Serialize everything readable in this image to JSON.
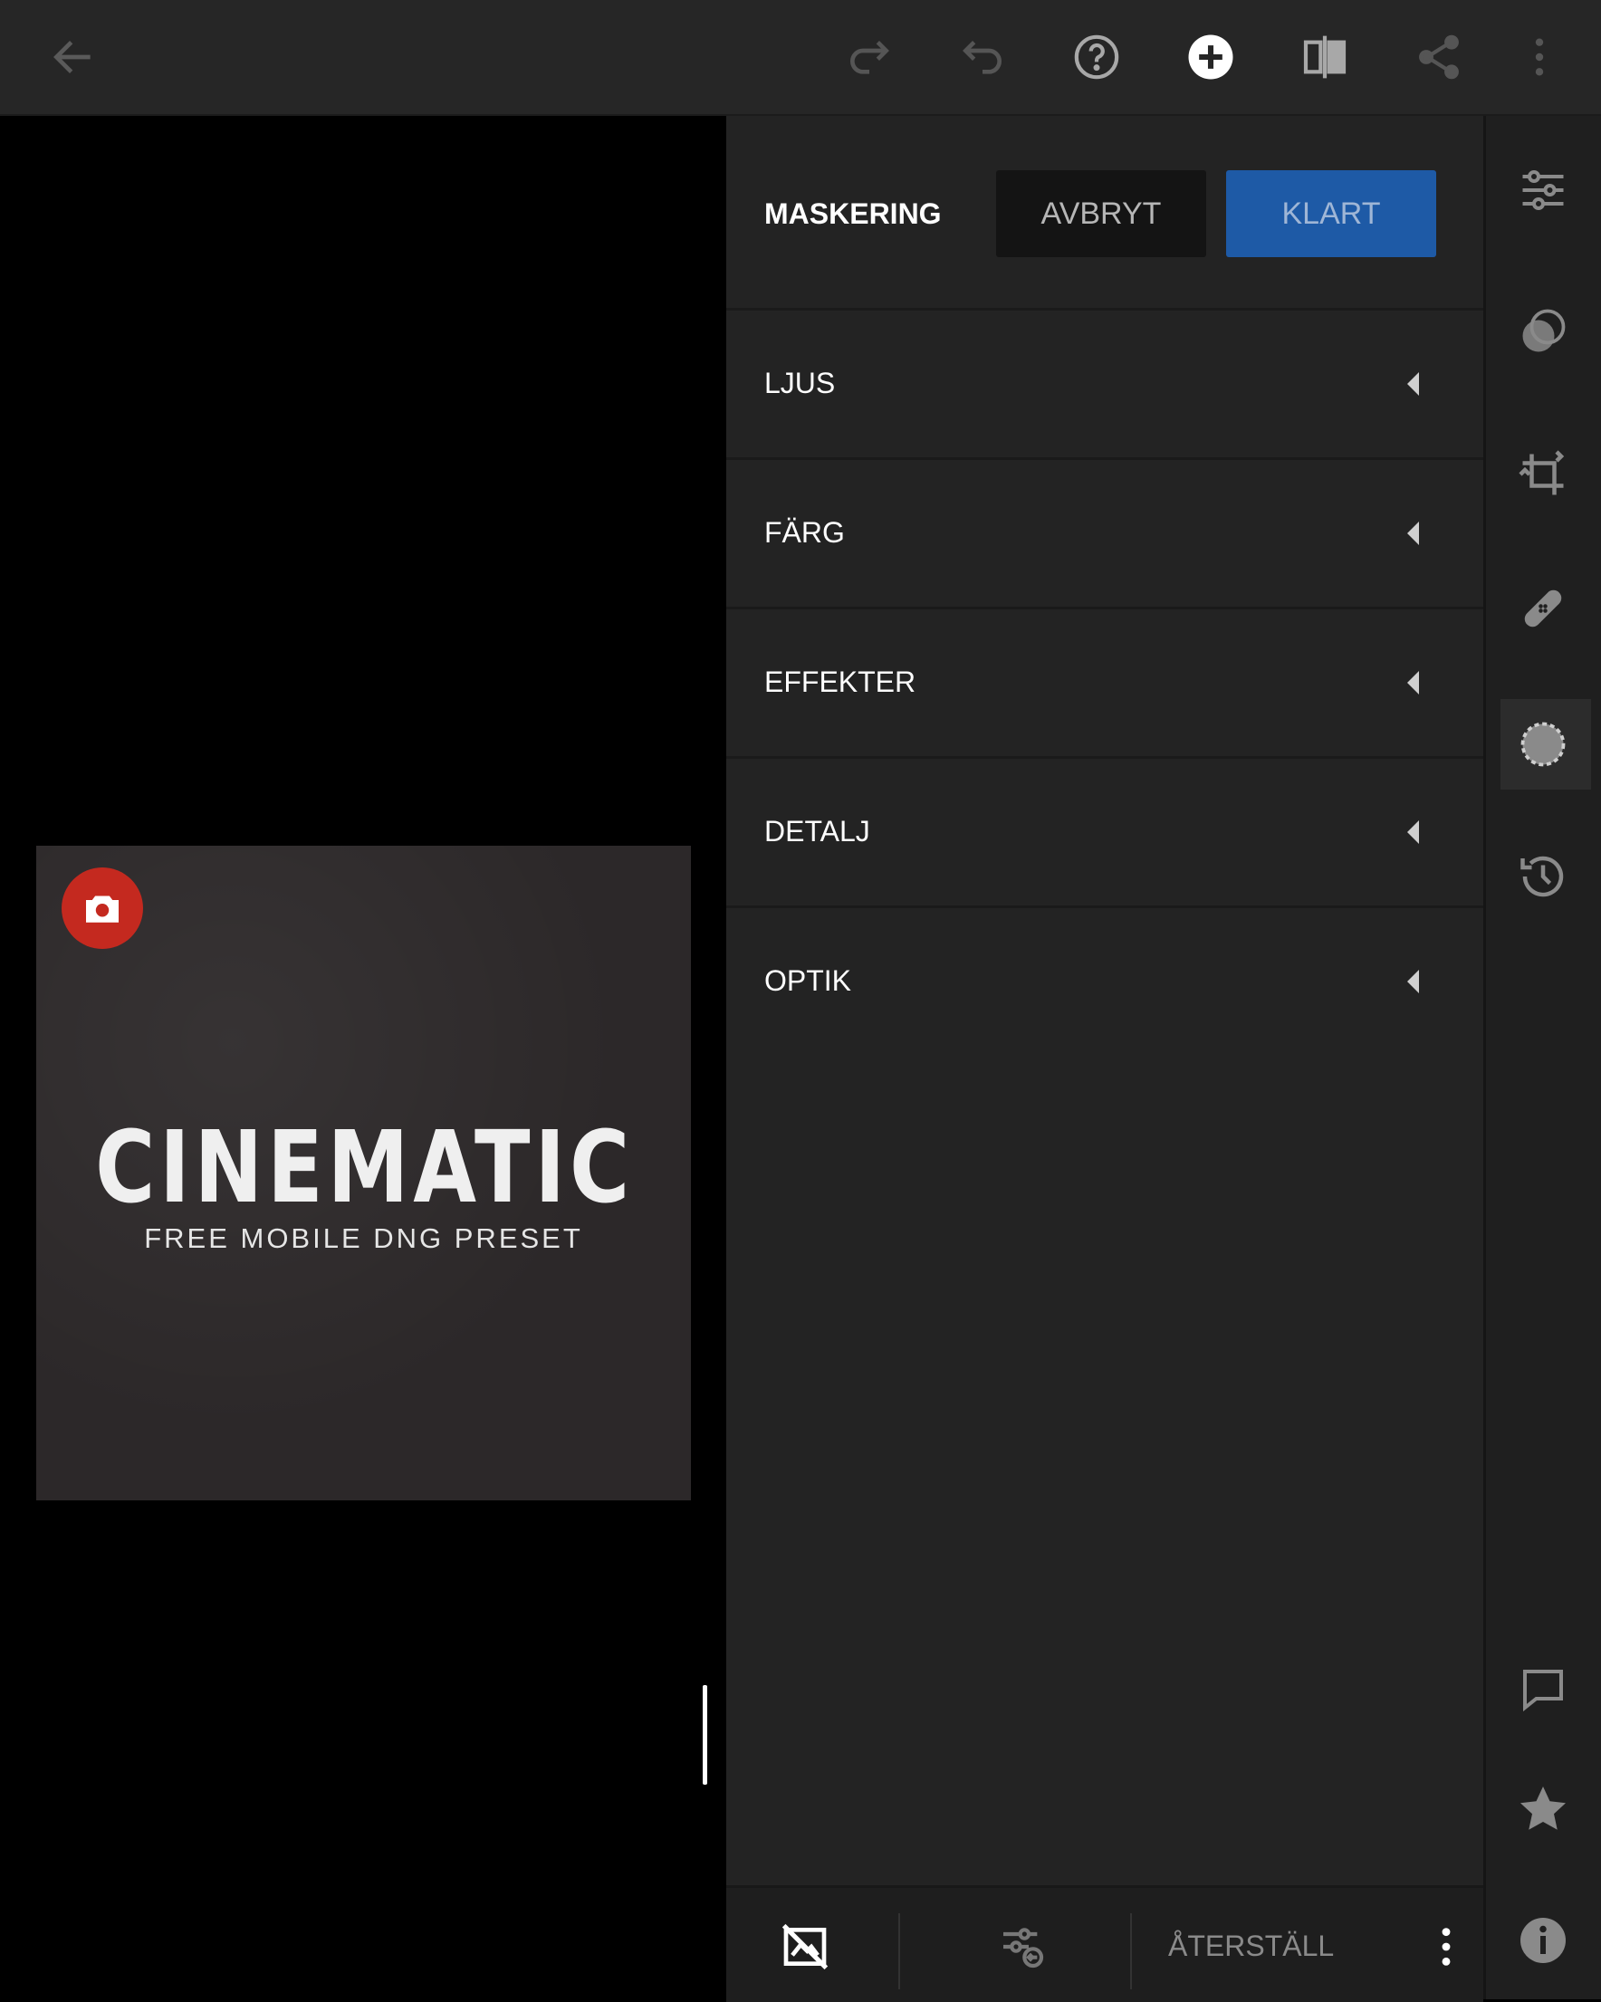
{
  "masking": {
    "title": "MASKERING",
    "cancel_label": "AVBRYT",
    "done_label": "KLART"
  },
  "sections": [
    {
      "label": "LJUS"
    },
    {
      "label": "FÄRG"
    },
    {
      "label": "EFFEKTER"
    },
    {
      "label": "DETALJ"
    },
    {
      "label": "OPTIK"
    }
  ],
  "bottombar": {
    "reset_label": "ÅTERSTÄLL"
  },
  "photo": {
    "title": "CINEMATIC",
    "subtitle": "FREE MOBILE DNG PRESET"
  },
  "icons": {
    "topbar": [
      "back-arrow-icon",
      "redo-icon",
      "undo-icon",
      "help-icon",
      "add-icon",
      "compare-icon",
      "share-icon",
      "more-vertical-icon"
    ],
    "rail": [
      "edit-sliders-icon",
      "presets-icon",
      "crop-icon",
      "healing-icon",
      "masking-icon",
      "history-icon",
      "comment-icon",
      "star-icon",
      "info-icon"
    ]
  },
  "colors": {
    "accent": "#1e5aa6",
    "badge": "#c4291f",
    "panel_bg": "#232323"
  }
}
